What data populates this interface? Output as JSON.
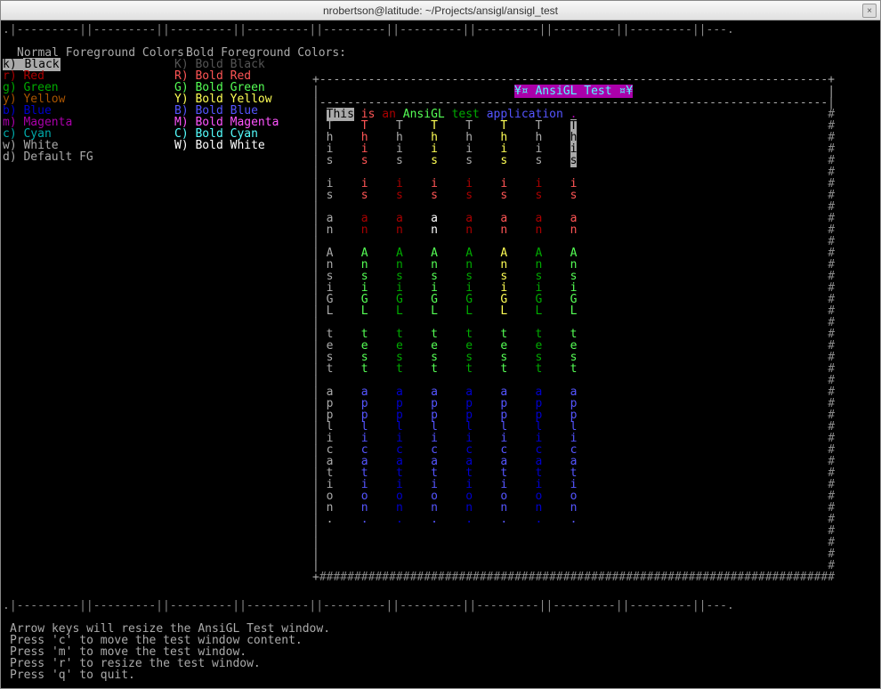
{
  "window": {
    "title": "nrobertson@latitude: ~/Projects/ansigl/ansigl_test"
  },
  "ruler": ".|---------||---------||---------||---------||---------||---------||---------||---------||---------||---.",
  "headers": {
    "normal": "Normal Foreground Colors:",
    "bold": "Bold Foreground Colors:"
  },
  "normal_colors": [
    {
      "key": "k)",
      "name": "Black",
      "cls": "fg-k",
      "sel": true
    },
    {
      "key": "r)",
      "name": "Red",
      "cls": "fg-r"
    },
    {
      "key": "g)",
      "name": "Green",
      "cls": "fg-g"
    },
    {
      "key": "y)",
      "name": "Yellow",
      "cls": "fg-y"
    },
    {
      "key": "b)",
      "name": "Blue",
      "cls": "fg-b"
    },
    {
      "key": "m)",
      "name": "Magenta",
      "cls": "fg-m"
    },
    {
      "key": "c)",
      "name": "Cyan",
      "cls": "fg-c"
    },
    {
      "key": "w)",
      "name": "White",
      "cls": "fg-w"
    },
    {
      "key": "d)",
      "name": "Default FG",
      "cls": "fg-d"
    }
  ],
  "bold_colors": [
    {
      "key": "K)",
      "name": "Bold Black",
      "cls": "bfg-k"
    },
    {
      "key": "R)",
      "name": "Bold Red",
      "cls": "bfg-r"
    },
    {
      "key": "G)",
      "name": "Bold Green",
      "cls": "bfg-g"
    },
    {
      "key": "Y)",
      "name": "Bold Yellow",
      "cls": "bfg-y"
    },
    {
      "key": "B)",
      "name": "Bold Blue",
      "cls": "bfg-b"
    },
    {
      "key": "M)",
      "name": "Bold Magenta",
      "cls": "bfg-m"
    },
    {
      "key": "C)",
      "name": "Bold Cyan",
      "cls": "bfg-c"
    },
    {
      "key": "W)",
      "name": "Bold White",
      "cls": "bfg-w"
    }
  ],
  "panel": {
    "title": "¥¤ AnsiGL Test ¤¥",
    "sentence": [
      {
        "word": "This",
        "cls": "sel"
      },
      {
        "word": "is",
        "cls": "bfg-r"
      },
      {
        "word": "an",
        "cls": "fg-r"
      },
      {
        "word": "AnsiGL",
        "cls": "bfg-g"
      },
      {
        "word": "test",
        "cls": "fg-g"
      },
      {
        "word": "application",
        "cls": "bfg-b"
      },
      {
        "word": ".",
        "cls": "fg-m"
      }
    ],
    "words": [
      "This",
      "is",
      "an",
      "AnsiGL",
      "test",
      "application."
    ],
    "columns_cls": [
      [
        "fg-w",
        "fg-w",
        "fg-w",
        "fg-w",
        "fg-w",
        "fg-w"
      ],
      [
        "bfg-r",
        "bfg-r",
        "fg-r",
        "bfg-g",
        "bfg-g",
        "bfg-b"
      ],
      [
        "fg-w",
        "fg-r",
        "fg-r",
        "fg-g",
        "fg-g",
        "fg-b"
      ],
      [
        "bfg-y",
        "bfg-r",
        "bfg-w",
        "bfg-g",
        "bfg-g",
        "bfg-b"
      ],
      [
        "fg-w",
        "fg-r",
        "fg-r",
        "fg-g",
        "fg-g",
        "fg-b"
      ],
      [
        "bfg-y",
        "bfg-r",
        "bfg-r",
        "bfg-y",
        "bfg-g",
        "bfg-b"
      ],
      [
        "fg-w",
        "fg-r",
        "fg-r",
        "fg-g",
        "fg-g",
        "fg-b"
      ],
      [
        "sel",
        "bfg-r",
        "bfg-r",
        "bfg-g",
        "bfg-g",
        "bfg-b"
      ]
    ]
  },
  "help": [
    "Arrow keys will resize the AnsiGL Test window.",
    "Press 'c' to move the test window content.",
    "Press 'm' to move the test window.",
    "Press 'r' to resize the test window.",
    "Press 'q' to quit."
  ]
}
